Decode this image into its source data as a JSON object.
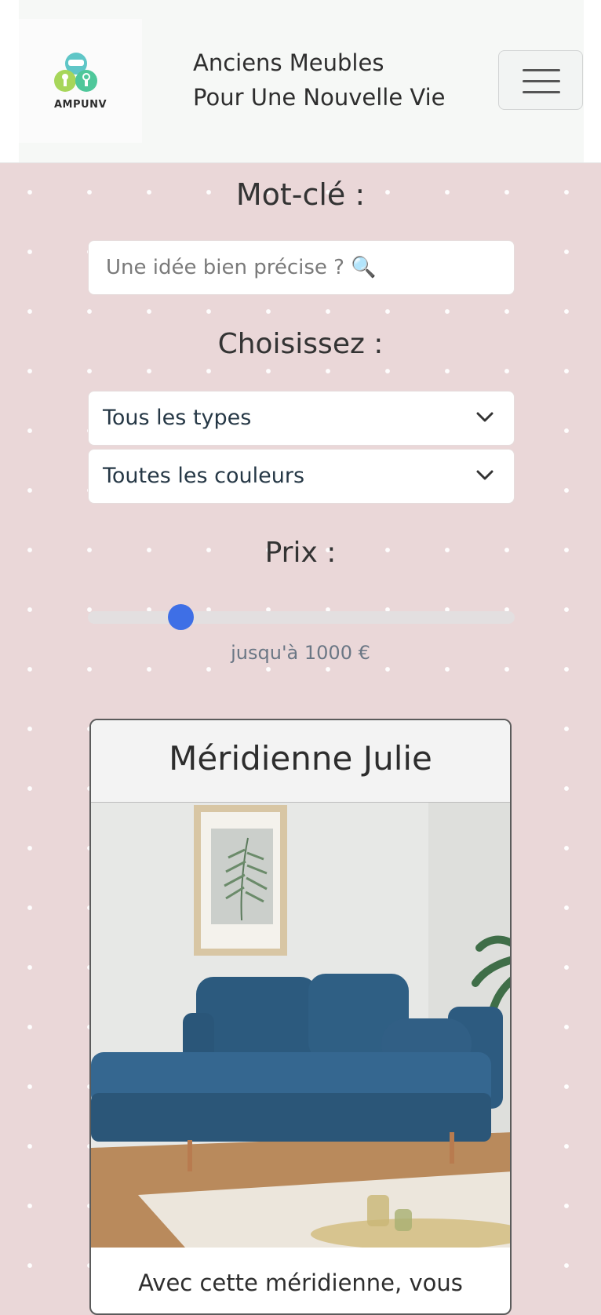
{
  "header": {
    "logo_text": "AMPUNV",
    "tagline_line1": "Anciens Meubles",
    "tagline_line2": "Pour Une Nouvelle Vie",
    "menu_icon": "hamburger-menu-icon"
  },
  "filters": {
    "keyword_label": "Mot-clé :",
    "search_placeholder": "Une idée bien précise ? 🔍",
    "choose_label": "Choisissez :",
    "type_select": {
      "selected": "Tous les types"
    },
    "color_select": {
      "selected": "Toutes les couleurs"
    },
    "price_label": "Prix :",
    "price_slider_fraction": 0.2,
    "price_value": "jusqu'à 1000 €"
  },
  "product": {
    "title": "Méridienne Julie",
    "image": "blue-velvet-chaise-longue-photo",
    "description": "Avec cette méridienne, vous"
  },
  "colors": {
    "background": "#ead7d8",
    "slider_thumb": "#3e6fe6"
  }
}
